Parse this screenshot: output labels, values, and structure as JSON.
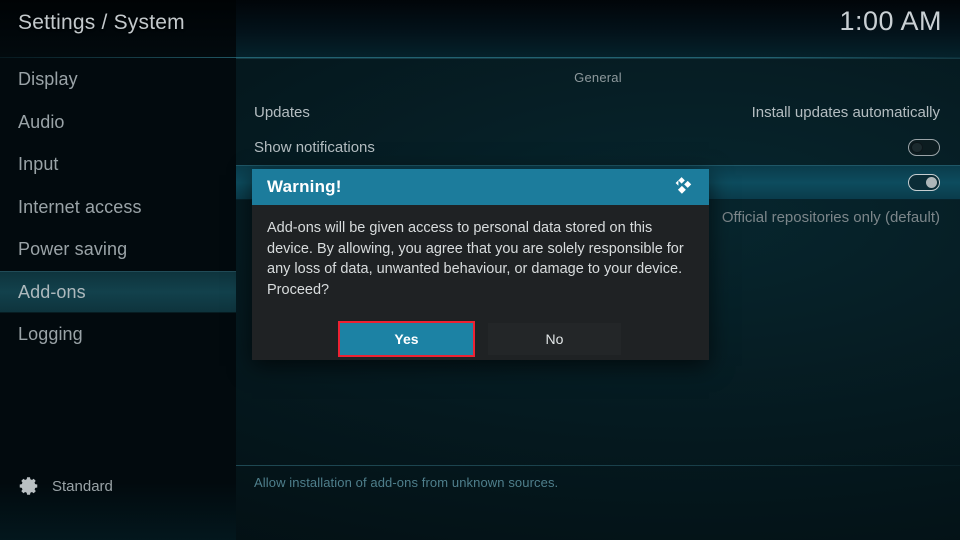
{
  "header": {
    "title": "Settings / System",
    "clock": "1:00 AM"
  },
  "sidebar": {
    "items": [
      {
        "label": "Display",
        "selected": false
      },
      {
        "label": "Audio",
        "selected": false
      },
      {
        "label": "Input",
        "selected": false
      },
      {
        "label": "Internet access",
        "selected": false
      },
      {
        "label": "Power saving",
        "selected": false
      },
      {
        "label": "Add-ons",
        "selected": true
      },
      {
        "label": "Logging",
        "selected": false
      }
    ],
    "profile": {
      "icon": "gear-icon",
      "label": "Standard"
    }
  },
  "content": {
    "section_header": "General",
    "rows": [
      {
        "label": "Updates",
        "value": "Install updates automatically",
        "control": "text",
        "highlight": false
      },
      {
        "label": "Show notifications",
        "value": "",
        "control": "toggle",
        "toggle_state": "off",
        "highlight": false
      },
      {
        "label": "",
        "value": "",
        "control": "toggle",
        "toggle_state": "on",
        "highlight": true
      },
      {
        "label": "",
        "value": "Official repositories only (default)",
        "control": "text",
        "highlight": false
      }
    ],
    "help_text": "Allow installation of add-ons from unknown sources."
  },
  "dialog": {
    "title": "Warning!",
    "logo_icon": "kodi-logo-icon",
    "message": "Add-ons will be given access to personal data stored on this device. By allowing, you agree that you are solely responsible for any loss of data, unwanted behaviour, or damage to your device. Proceed?",
    "buttons": {
      "confirm": "Yes",
      "cancel": "No"
    },
    "focused_button": "Yes"
  },
  "colors": {
    "accent_teal": "#1c82a4",
    "dialog_title_bg": "#1c7c9c",
    "row_highlight": "#0d4c5e",
    "sidebar_highlight": "#12414c",
    "focus_outline": "#ee2233",
    "help_text": "#4f7f8c"
  }
}
